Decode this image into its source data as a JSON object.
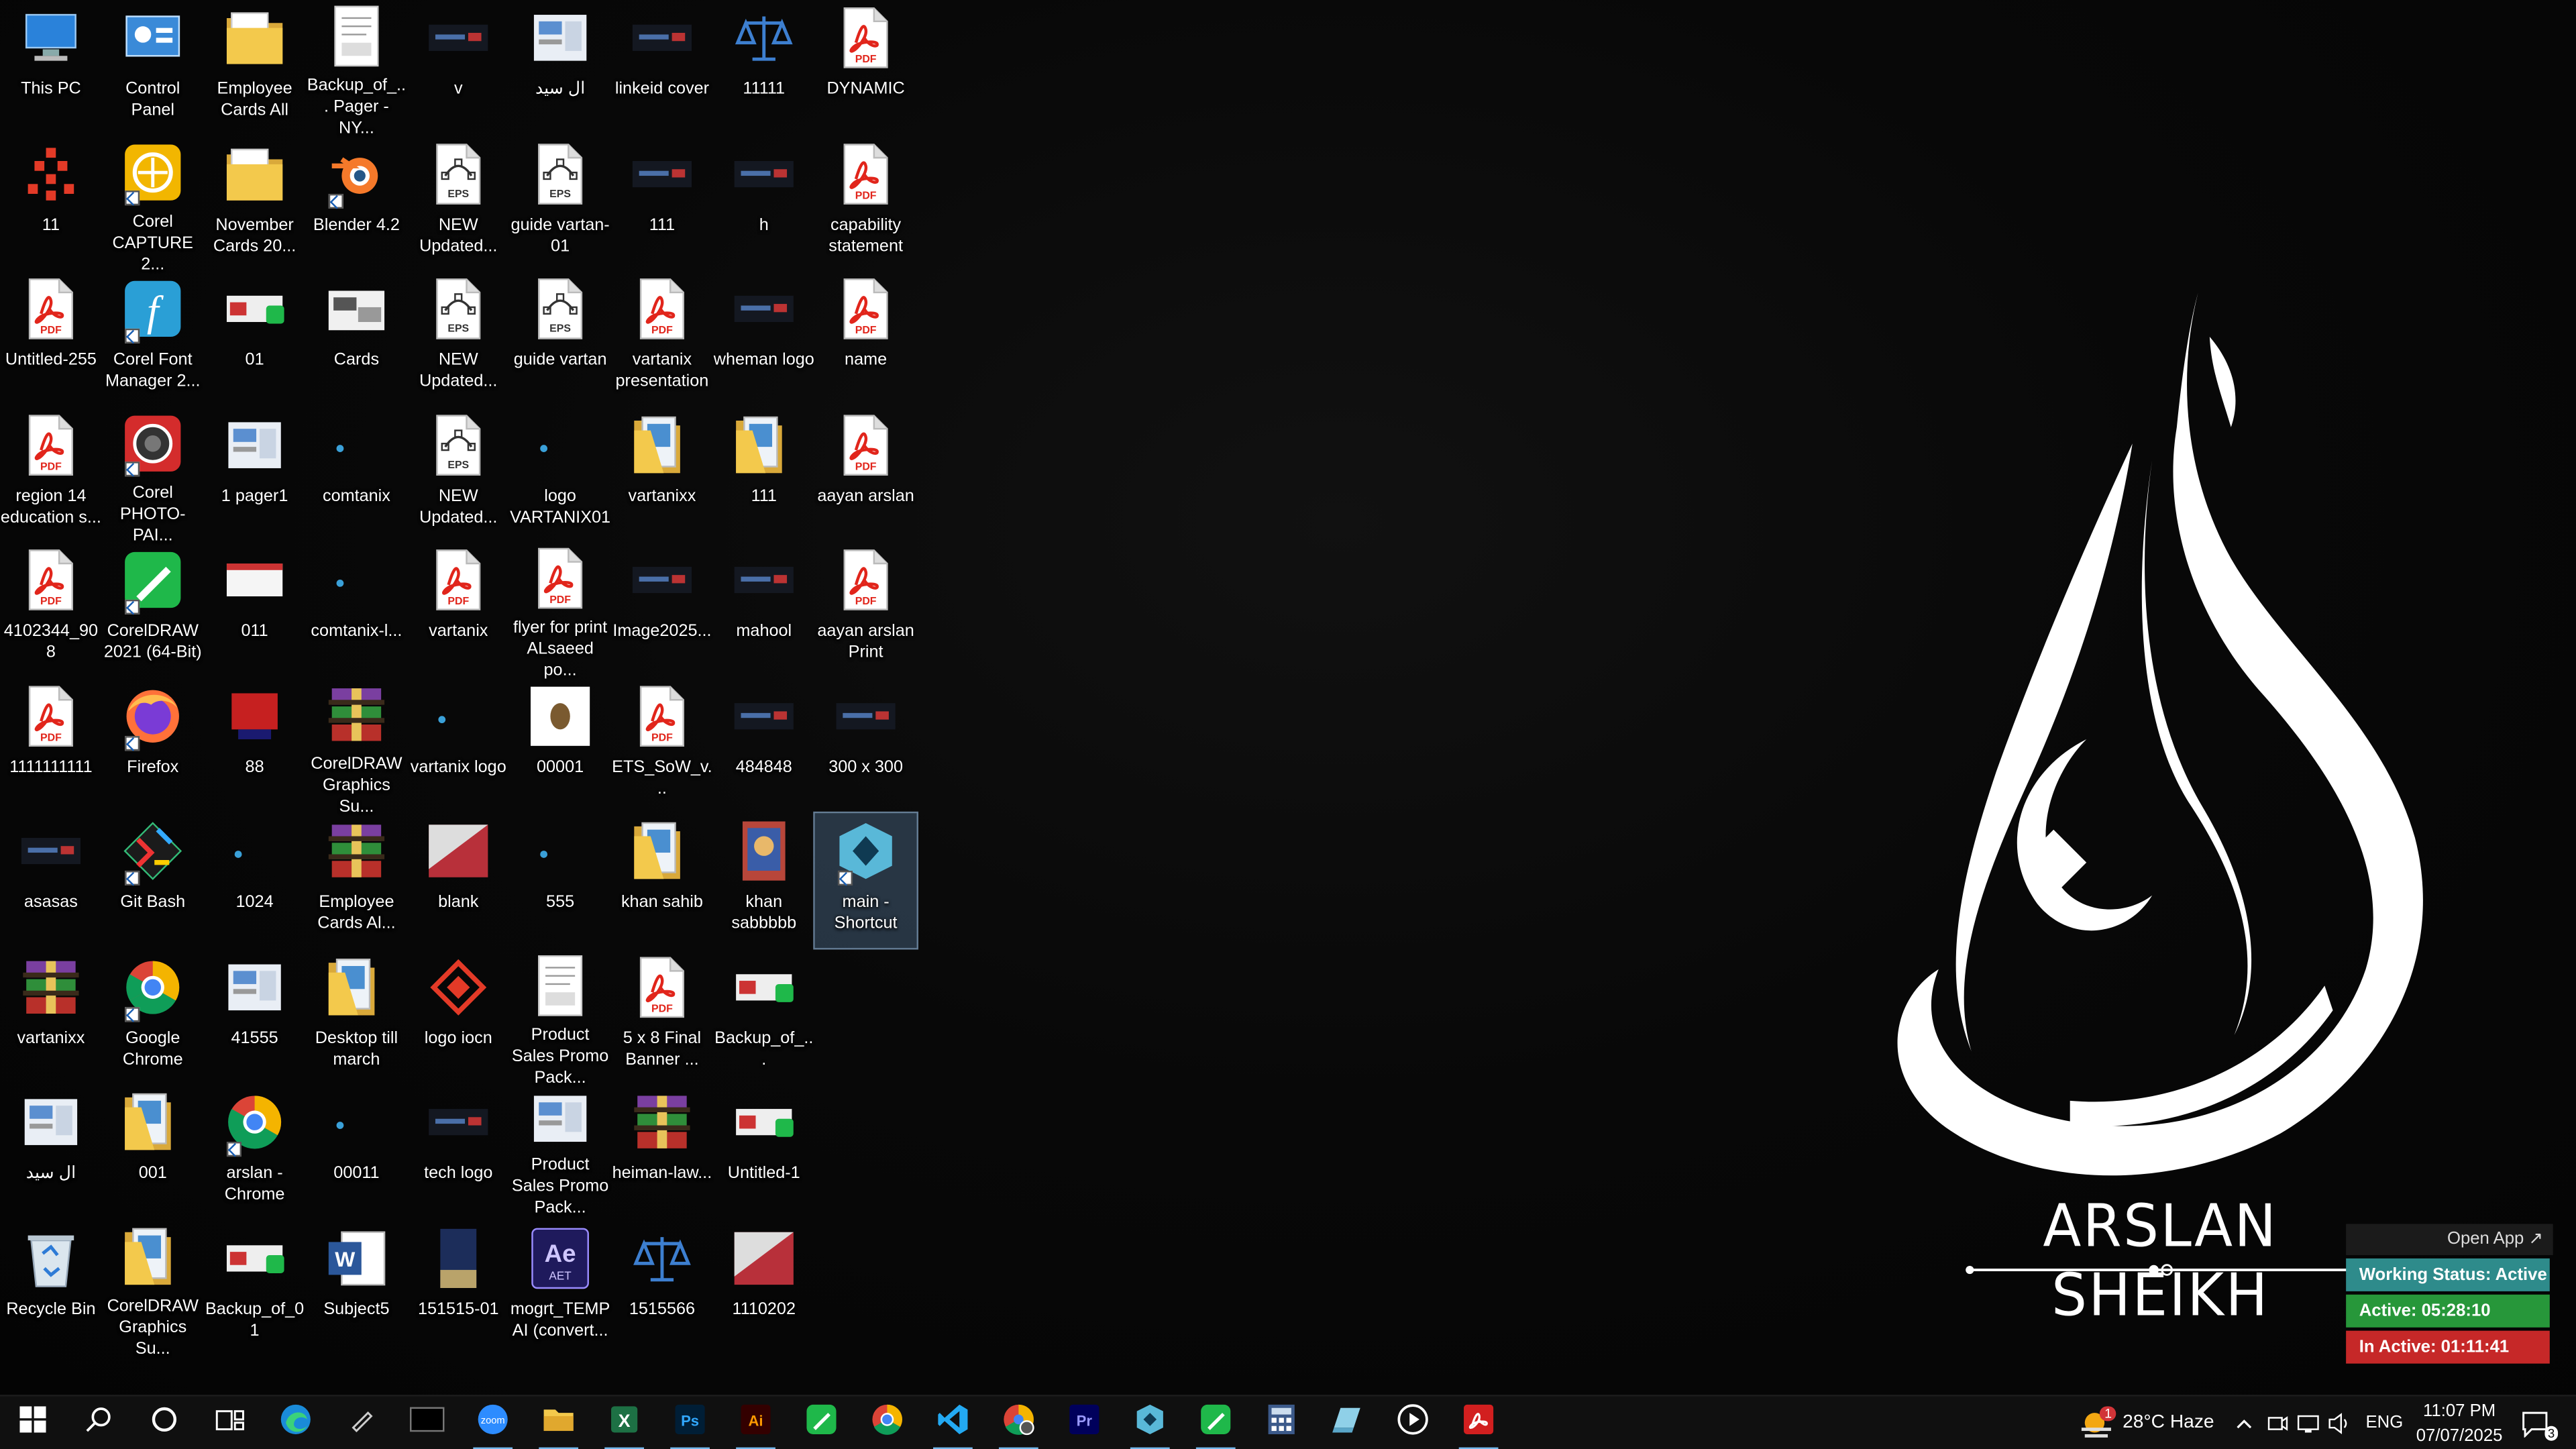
{
  "desktop_icons": [
    {
      "label": "This PC",
      "col": 0,
      "row": 0,
      "icon": "this-pc"
    },
    {
      "label": "11",
      "col": 0,
      "row": 1,
      "icon": "dots-logo"
    },
    {
      "label": "Untitled-255",
      "col": 0,
      "row": 2,
      "icon": "pdf"
    },
    {
      "label": "region 14 education s...",
      "col": 0,
      "row": 3,
      "icon": "pdf"
    },
    {
      "label": "4102344_908",
      "col": 0,
      "row": 4,
      "icon": "pdf"
    },
    {
      "label": "1111111111",
      "col": 0,
      "row": 5,
      "icon": "pdf"
    },
    {
      "label": "asasas",
      "col": 0,
      "row": 6,
      "icon": "dark-thumb"
    },
    {
      "label": "vartanixx",
      "col": 0,
      "row": 7,
      "icon": "winrar"
    },
    {
      "label": "ال سيد",
      "col": 0,
      "row": 8,
      "icon": "doc-thumb"
    },
    {
      "label": "Recycle Bin",
      "col": 0,
      "row": 9,
      "icon": "recycle-bin"
    },
    {
      "label": "Control Panel",
      "col": 1,
      "row": 0,
      "icon": "control-panel"
    },
    {
      "label": "Corel CAPTURE 2...",
      "col": 1,
      "row": 1,
      "icon": "corel-capture",
      "shortcut": true
    },
    {
      "label": "Corel Font Manager 2...",
      "col": 1,
      "row": 2,
      "icon": "corel-font",
      "shortcut": true
    },
    {
      "label": "Corel PHOTO-PAI...",
      "col": 1,
      "row": 3,
      "icon": "corel-photo",
      "shortcut": true
    },
    {
      "label": "CorelDRAW 2021 (64-Bit)",
      "col": 1,
      "row": 4,
      "icon": "coreldraw",
      "shortcut": true
    },
    {
      "label": "Firefox",
      "col": 1,
      "row": 5,
      "icon": "firefox",
      "shortcut": true
    },
    {
      "label": "Git Bash",
      "col": 1,
      "row": 6,
      "icon": "git-bash",
      "shortcut": true
    },
    {
      "label": "Google Chrome",
      "col": 1,
      "row": 7,
      "icon": "chrome",
      "shortcut": true
    },
    {
      "label": "001",
      "col": 1,
      "row": 8,
      "icon": "folder-doc"
    },
    {
      "label": "CorelDRAW Graphics Su...",
      "col": 1,
      "row": 9,
      "icon": "folder-doc"
    },
    {
      "label": "Employee Cards All",
      "col": 2,
      "row": 0,
      "icon": "folder"
    },
    {
      "label": "November Cards 20...",
      "col": 2,
      "row": 1,
      "icon": "folder"
    },
    {
      "label": "01",
      "col": 2,
      "row": 2,
      "icon": "cdr-thumb"
    },
    {
      "label": "1 pager1",
      "col": 2,
      "row": 3,
      "icon": "doc-thumb"
    },
    {
      "label": "011",
      "col": 2,
      "row": 4,
      "icon": "card-thumb"
    },
    {
      "label": "88",
      "col": 2,
      "row": 5,
      "icon": "red-thumb"
    },
    {
      "label": "1024",
      "col": 2,
      "row": 6,
      "icon": "small-dot"
    },
    {
      "label": "41555",
      "col": 2,
      "row": 7,
      "icon": "doc-thumb"
    },
    {
      "label": "arslan - Chrome",
      "col": 2,
      "row": 8,
      "icon": "chrome",
      "shortcut": true
    },
    {
      "label": "Backup_of_01",
      "col": 2,
      "row": 9,
      "icon": "cdr-thumb"
    },
    {
      "label": "Backup_of_... Pager - NY...",
      "col": 3,
      "row": 0,
      "icon": "doc-page"
    },
    {
      "label": "Blender 4.2",
      "col": 3,
      "row": 1,
      "icon": "blender",
      "shortcut": true
    },
    {
      "label": "Cards",
      "col": 3,
      "row": 2,
      "icon": "cards-thumb"
    },
    {
      "label": "comtanix",
      "col": 3,
      "row": 3,
      "icon": "small-dot"
    },
    {
      "label": "comtanix-l...",
      "col": 3,
      "row": 4,
      "icon": "small-dot"
    },
    {
      "label": "CorelDRAW Graphics Su...",
      "col": 3,
      "row": 5,
      "icon": "winrar"
    },
    {
      "label": "Employee Cards Al...",
      "col": 3,
      "row": 6,
      "icon": "winrar"
    },
    {
      "label": "Desktop till march",
      "col": 3,
      "row": 7,
      "icon": "folder-doc"
    },
    {
      "label": "00011",
      "col": 3,
      "row": 8,
      "icon": "small-dot"
    },
    {
      "label": "Subject5",
      "col": 3,
      "row": 9,
      "icon": "word"
    },
    {
      "label": "v",
      "col": 4,
      "row": 0,
      "icon": "dark-thumb"
    },
    {
      "label": "NEW Updated...",
      "col": 4,
      "row": 1,
      "icon": "eps"
    },
    {
      "label": "NEW Updated...",
      "col": 4,
      "row": 2,
      "icon": "eps"
    },
    {
      "label": "NEW Updated...",
      "col": 4,
      "row": 3,
      "icon": "eps"
    },
    {
      "label": "vartanix",
      "col": 4,
      "row": 4,
      "icon": "pdf"
    },
    {
      "label": "vartanix logo",
      "col": 4,
      "row": 5,
      "icon": "small-dot"
    },
    {
      "label": "blank",
      "col": 4,
      "row": 6,
      "icon": "blank-thumb"
    },
    {
      "label": "logo iocn",
      "col": 4,
      "row": 7,
      "icon": "logo-icon"
    },
    {
      "label": "tech logo",
      "col": 4,
      "row": 8,
      "icon": "dark-thumb"
    },
    {
      "label": "151515-01",
      "col": 4,
      "row": 9,
      "icon": "tall-thumb"
    },
    {
      "label": "ال سيد",
      "col": 5,
      "row": 0,
      "icon": "doc-thumb"
    },
    {
      "label": "guide vartan-01",
      "col": 5,
      "row": 1,
      "icon": "eps"
    },
    {
      "label": "guide vartan",
      "col": 5,
      "row": 2,
      "icon": "eps"
    },
    {
      "label": "logo VARTANIX01",
      "col": 5,
      "row": 3,
      "icon": "small-dot"
    },
    {
      "label": "flyer for print ALsaeed po...",
      "col": 5,
      "row": 4,
      "icon": "pdf"
    },
    {
      "label": "00001",
      "col": 5,
      "row": 5,
      "icon": "white-thumb"
    },
    {
      "label": "555",
      "col": 5,
      "row": 6,
      "icon": "small-dot"
    },
    {
      "label": "Product Sales Promo Pack...",
      "col": 5,
      "row": 7,
      "icon": "doc-page"
    },
    {
      "label": "Product Sales Promo Pack...",
      "col": 5,
      "row": 8,
      "icon": "doc-thumb"
    },
    {
      "label": "mogrt_TEMP AI (convert...",
      "col": 5,
      "row": 9,
      "icon": "after-effects"
    },
    {
      "label": "linkeid cover",
      "col": 6,
      "row": 0,
      "icon": "dark-thumb"
    },
    {
      "label": "111",
      "col": 6,
      "row": 1,
      "icon": "dark-thumb"
    },
    {
      "label": "vartanix presentation",
      "col": 6,
      "row": 2,
      "icon": "pdf"
    },
    {
      "label": "vartanixx",
      "col": 6,
      "row": 3,
      "icon": "folder-doc"
    },
    {
      "label": "Image2025...",
      "col": 6,
      "row": 4,
      "icon": "dark-thumb"
    },
    {
      "label": "ETS_SoW_v...",
      "col": 6,
      "row": 5,
      "icon": "pdf"
    },
    {
      "label": "khan sahib",
      "col": 6,
      "row": 6,
      "icon": "folder-doc"
    },
    {
      "label": "5 x 8 Final Banner ...",
      "col": 6,
      "row": 7,
      "icon": "pdf"
    },
    {
      "label": "heiman-law...",
      "col": 6,
      "row": 8,
      "icon": "winrar"
    },
    {
      "label": "1515566",
      "col": 6,
      "row": 9,
      "icon": "scales"
    },
    {
      "label": "11111",
      "col": 7,
      "row": 0,
      "icon": "scales"
    },
    {
      "label": "h",
      "col": 7,
      "row": 1,
      "icon": "dark-thumb"
    },
    {
      "label": "wheman logo",
      "col": 7,
      "row": 2,
      "icon": "dark-thumb"
    },
    {
      "label": "111",
      "col": 7,
      "row": 3,
      "icon": "folder-doc"
    },
    {
      "label": "mahool",
      "col": 7,
      "row": 4,
      "icon": "dark-thumb"
    },
    {
      "label": "484848",
      "col": 7,
      "row": 5,
      "icon": "dark-thumb"
    },
    {
      "label": "khan sabbbbb",
      "col": 7,
      "row": 6,
      "icon": "poster-thumb"
    },
    {
      "label": "Backup_of_...",
      "col": 7,
      "row": 7,
      "icon": "cdr-thumb"
    },
    {
      "label": "Untitled-1",
      "col": 7,
      "row": 8,
      "icon": "cdr-thumb"
    },
    {
      "label": "1110202",
      "col": 7,
      "row": 9,
      "icon": "blank-thumb"
    },
    {
      "label": "DYNAMIC",
      "col": 8,
      "row": 0,
      "icon": "pdf"
    },
    {
      "label": "capability statement",
      "col": 8,
      "row": 1,
      "icon": "pdf"
    },
    {
      "label": "name",
      "col": 8,
      "row": 2,
      "icon": "pdf"
    },
    {
      "label": "aayan arslan",
      "col": 8,
      "row": 3,
      "icon": "pdf"
    },
    {
      "label": "aayan arslan Print",
      "col": 8,
      "row": 4,
      "icon": "pdf"
    },
    {
      "label": "300 x 300",
      "col": 8,
      "row": 5,
      "icon": "dark-thumb"
    },
    {
      "label": "main - Shortcut",
      "col": 8,
      "row": 6,
      "icon": "app-shortcut",
      "shortcut": true,
      "selected": true
    }
  ],
  "wallpaper": {
    "brand_text": "ARSLAN SHEIKH"
  },
  "tracker": {
    "open_app": "Open App ↗",
    "status": "Working Status: Active",
    "active": "Active: 05:28:10",
    "inactive": "In Active: 01:11:41",
    "colors": {
      "status": "#2e8b8b",
      "active": "#27973a",
      "inactive": "#c62828"
    }
  },
  "taskbar": {
    "apps": [
      {
        "name": "start",
        "icon": "windows-icon"
      },
      {
        "name": "search",
        "icon": "search-icon"
      },
      {
        "name": "cortana",
        "icon": "cortana-icon"
      },
      {
        "name": "task-view",
        "icon": "task-view-icon"
      },
      {
        "name": "edge",
        "icon": "edge-icon"
      },
      {
        "name": "pen",
        "icon": "pen-icon"
      },
      {
        "name": "terminal",
        "icon": "terminal-icon"
      },
      {
        "name": "zoom",
        "icon": "zoom-icon",
        "running": true
      },
      {
        "name": "file-explorer",
        "icon": "folder-icon",
        "running": true
      },
      {
        "name": "excel",
        "icon": "excel-icon",
        "running": true
      },
      {
        "name": "photoshop",
        "icon": "photoshop-icon",
        "running": true
      },
      {
        "name": "illustrator",
        "icon": "illustrator-icon",
        "running": true
      },
      {
        "name": "coreldraw",
        "icon": "coreldraw-icon"
      },
      {
        "name": "chrome",
        "icon": "chrome-icon"
      },
      {
        "name": "vscode",
        "icon": "vscode-icon",
        "running": true
      },
      {
        "name": "chrome-profile",
        "icon": "chrome-profile-icon",
        "running": true
      },
      {
        "name": "premiere",
        "icon": "premiere-icon"
      },
      {
        "name": "app",
        "icon": "app-icon",
        "running": true
      },
      {
        "name": "coreldraw-2",
        "icon": "coreldraw-icon",
        "running": true
      },
      {
        "name": "calculator",
        "icon": "calculator-icon"
      },
      {
        "name": "notes",
        "icon": "notes-icon"
      },
      {
        "name": "media-player",
        "icon": "play-icon"
      },
      {
        "name": "acrobat",
        "icon": "acrobat-icon",
        "running": true
      }
    ],
    "weather_badge": "1",
    "weather": "28°C  Haze",
    "language": "ENG",
    "time": "11:07 PM",
    "date": "07/07/2025",
    "notifications": "3"
  }
}
